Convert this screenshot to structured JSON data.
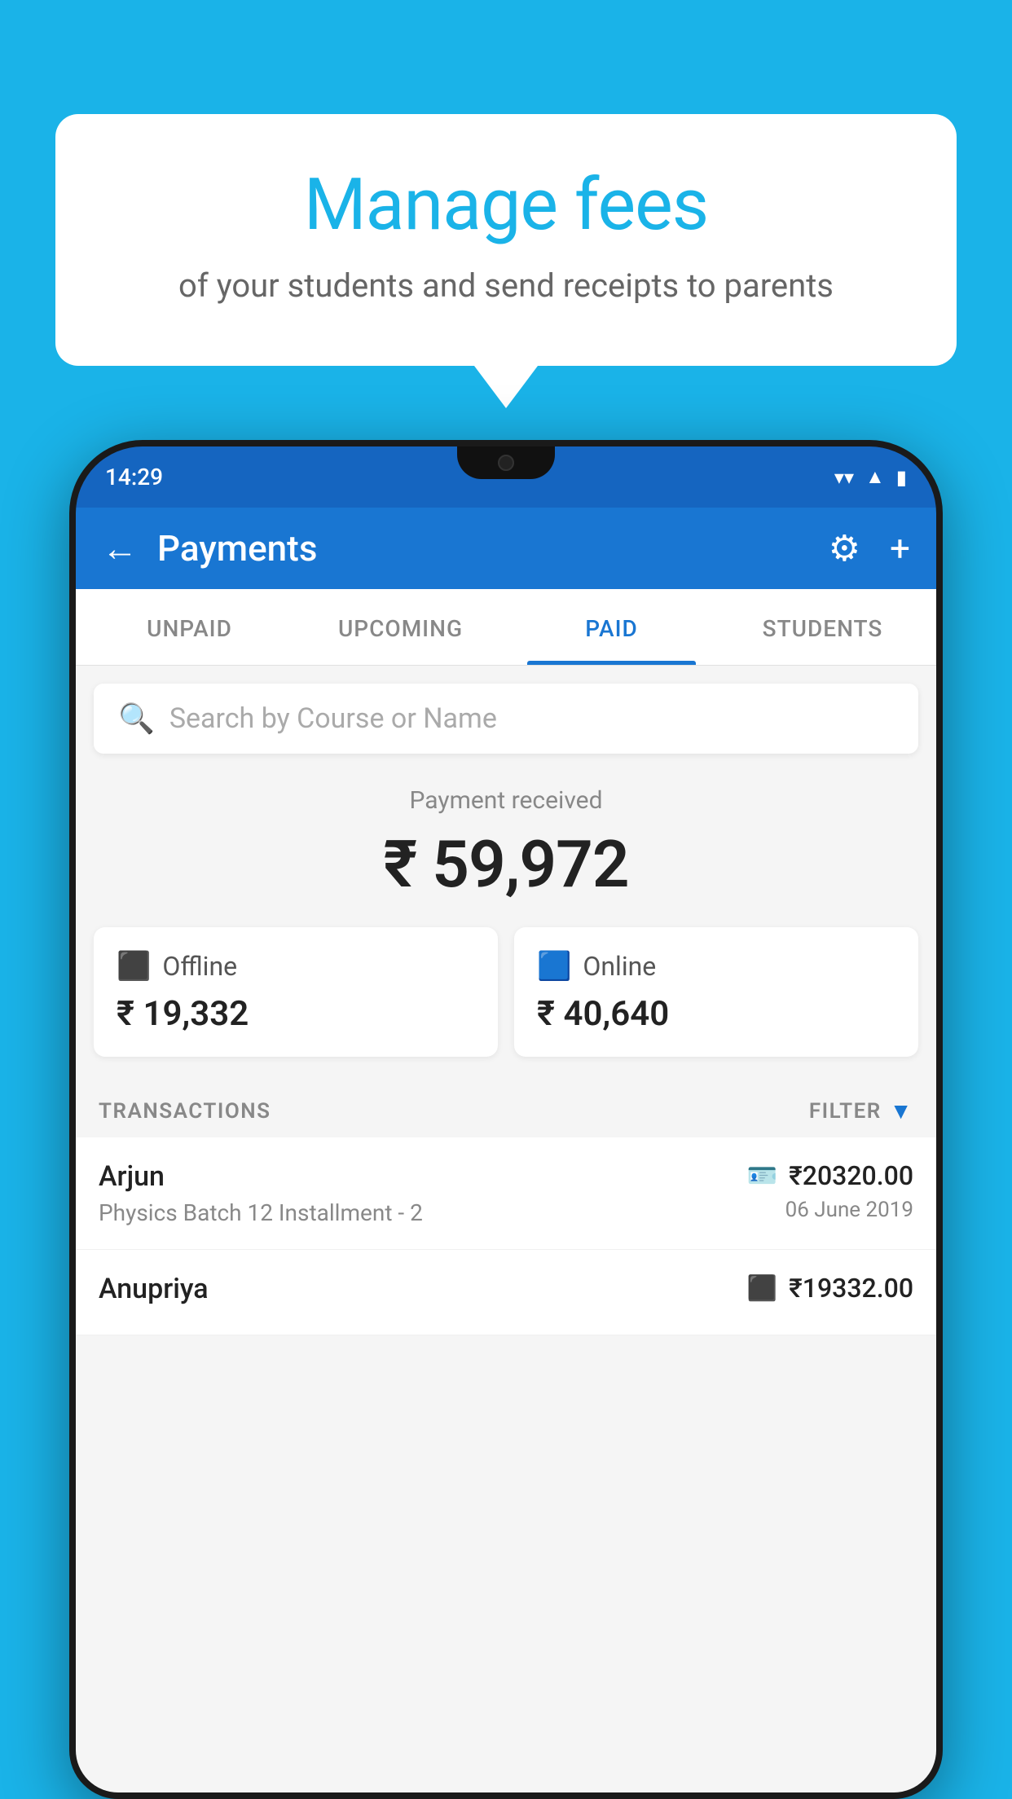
{
  "background_color": "#1ab3e8",
  "bubble": {
    "title": "Manage fees",
    "subtitle": "of your students and send receipts to parents"
  },
  "status_bar": {
    "time": "14:29",
    "wifi_icon": "▲",
    "signal_icon": "▲",
    "battery_icon": "▮"
  },
  "header": {
    "title": "Payments",
    "back_label": "←",
    "settings_label": "⚙",
    "add_label": "+"
  },
  "tabs": [
    {
      "label": "UNPAID",
      "active": false
    },
    {
      "label": "UPCOMING",
      "active": false
    },
    {
      "label": "PAID",
      "active": true
    },
    {
      "label": "STUDENTS",
      "active": false
    }
  ],
  "search": {
    "placeholder": "Search by Course or Name"
  },
  "payment_received": {
    "label": "Payment received",
    "amount": "₹ 59,972"
  },
  "payment_cards": [
    {
      "type": "Offline",
      "amount": "₹ 19,332",
      "icon": "💳"
    },
    {
      "type": "Online",
      "amount": "₹ 40,640",
      "icon": "💳"
    }
  ],
  "transactions_section": {
    "label": "TRANSACTIONS",
    "filter_label": "FILTER"
  },
  "transactions": [
    {
      "name": "Arjun",
      "course": "Physics Batch 12 Installment - 2",
      "amount": "₹20320.00",
      "date": "06 June 2019",
      "payment_type": "card"
    },
    {
      "name": "Anupriya",
      "course": "",
      "amount": "₹19332.00",
      "date": "",
      "payment_type": "cash"
    }
  ]
}
